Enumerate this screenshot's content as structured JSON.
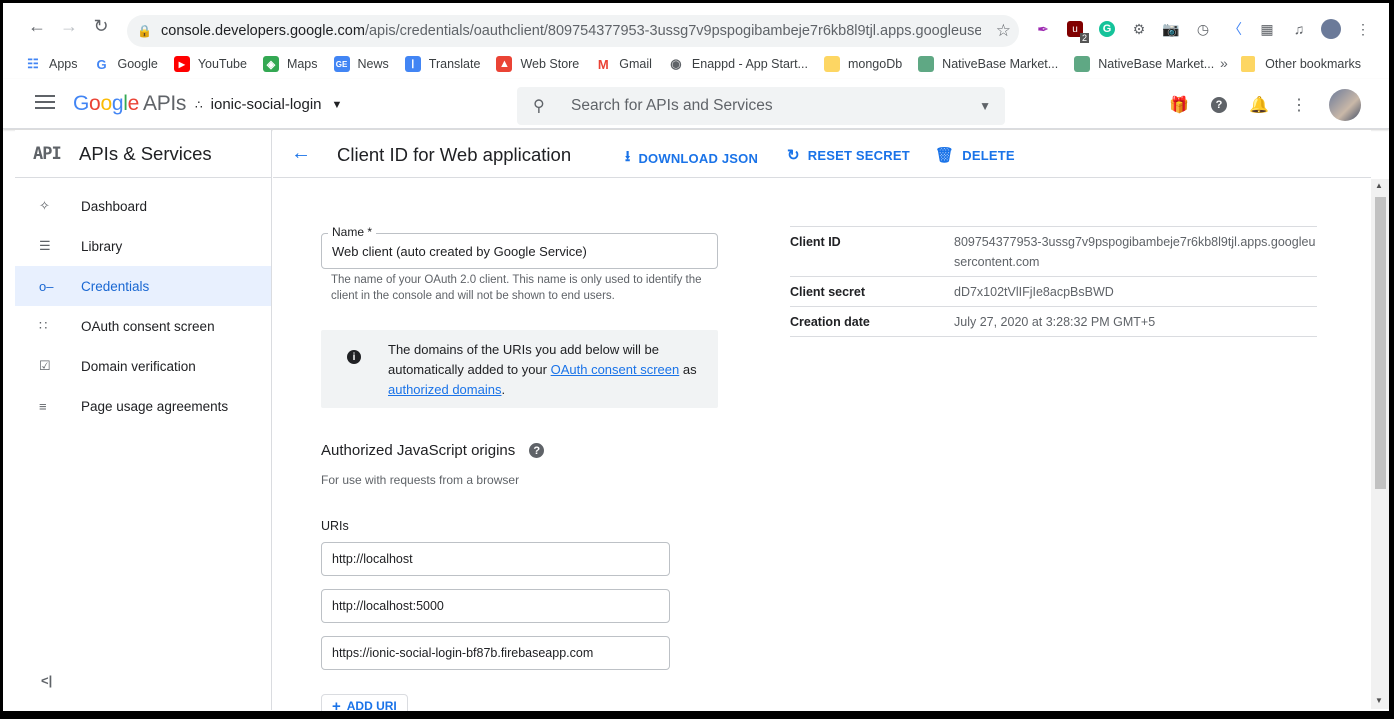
{
  "browser": {
    "url_host": "console.developers.google.com",
    "url_path": "/apis/credentials/oauthclient/809754377953-3ussg7v9pspogibambeje7r6kb8l9tjl.apps.googleuserc...",
    "bookmarks": [
      {
        "label": "Apps",
        "icon": "apps-grid-icon",
        "color": "#4285f4"
      },
      {
        "label": "Google",
        "icon": "google-icon",
        "color": "#ea4335"
      },
      {
        "label": "YouTube",
        "icon": "youtube-icon",
        "color": "#ff0000"
      },
      {
        "label": "Maps",
        "icon": "maps-icon",
        "color": "#34a853"
      },
      {
        "label": "News",
        "icon": "news-icon",
        "color": "#4285f4"
      },
      {
        "label": "Translate",
        "icon": "translate-icon",
        "color": "#4285f4"
      },
      {
        "label": "Web Store",
        "icon": "webstore-icon",
        "color": "#ea4335"
      },
      {
        "label": "Gmail",
        "icon": "gmail-icon",
        "color": "#ea4335"
      },
      {
        "label": "Enappd - App Start...",
        "icon": "globe-icon",
        "color": "#5f6368"
      },
      {
        "label": "mongoDb",
        "icon": "folder-icon",
        "color": "#fdd663"
      },
      {
        "label": "NativeBase Market...",
        "icon": "nativebase-icon",
        "color": "#5fa884"
      },
      {
        "label": "NativeBase Market...",
        "icon": "nativebase-icon",
        "color": "#5fa884"
      }
    ],
    "other_bookmarks": "Other bookmarks",
    "extension_badge": "2"
  },
  "header": {
    "logo_google": "Google",
    "logo_apis": "APIs",
    "project": "ionic-social-login",
    "search_placeholder": "Search for APIs and Services"
  },
  "sidebar": {
    "badge": "API",
    "title": "APIs & Services",
    "items": [
      {
        "label": "Dashboard",
        "icon": "dashboard-icon"
      },
      {
        "label": "Library",
        "icon": "library-icon"
      },
      {
        "label": "Credentials",
        "icon": "key-icon"
      },
      {
        "label": "OAuth consent screen",
        "icon": "consent-icon"
      },
      {
        "label": "Domain verification",
        "icon": "checkbox-icon"
      },
      {
        "label": "Page usage agreements",
        "icon": "settings-list-icon"
      }
    ],
    "active_index": 2
  },
  "main": {
    "title": "Client ID for Web application",
    "actions": {
      "download": "DOWNLOAD JSON",
      "reset": "RESET SECRET",
      "delete": "DELETE"
    },
    "name_label": "Name *",
    "name_value": "Web client  (auto created by Google Service)",
    "name_help": "The name of your OAuth 2.0 client. This name is only used to identify the client in the console and will not be shown to end users.",
    "info_text_1": "The domains of the URIs you add below will be automatically added to your ",
    "info_link_1": "OAuth consent screen",
    "info_text_2": " as ",
    "info_link_2": "authorized domains",
    "info_text_3": ".",
    "origins_title": "Authorized JavaScript origins",
    "origins_sub": "For use with requests from a browser",
    "uris_label": "URIs",
    "uris": [
      "http://localhost",
      "http://localhost:5000",
      "https://ionic-social-login-bf87b.firebaseapp.com"
    ],
    "add_uri": "ADD URI"
  },
  "client_info": {
    "client_id_label": "Client ID",
    "client_id": "809754377953-3ussg7v9pspogibambeje7r6kb8l9tjl.apps.googleusercontent.com",
    "secret_label": "Client secret",
    "secret": "dD7x102tVlIFjIe8acpBsBWD",
    "created_label": "Creation date",
    "created": "July 27, 2020 at 3:28:32 PM GMT+5"
  },
  "colors": {
    "accent": "#1a73e8",
    "active_bg": "#e8f0fe"
  }
}
